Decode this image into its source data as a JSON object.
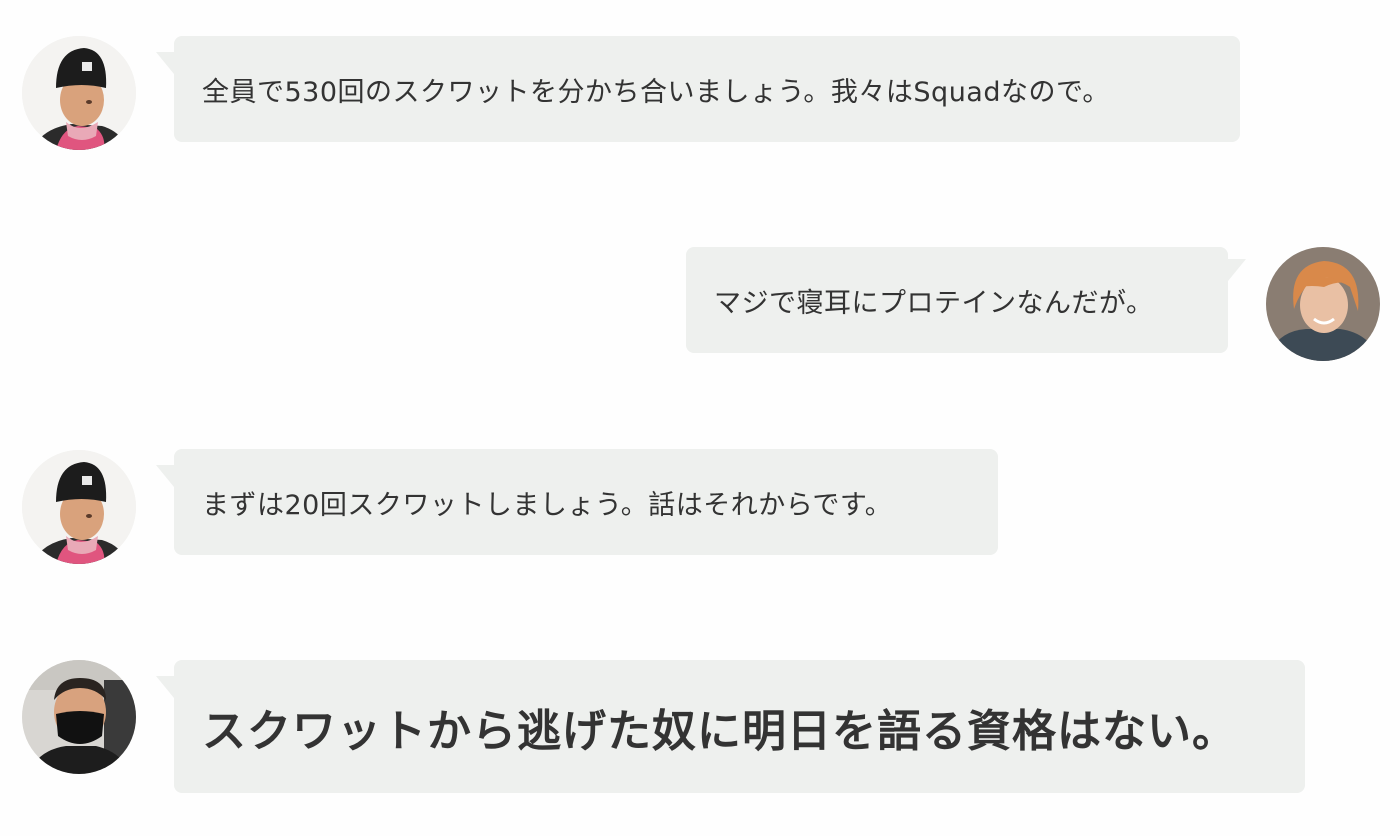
{
  "conversation": {
    "messages": [
      {
        "side": "left",
        "avatar": "avatar-man-beanie-pink-hoodie",
        "text": "全員で530回のスクワットを分かち合いましょう。我々はSquadなので。"
      },
      {
        "side": "right",
        "avatar": "avatar-woman-short-orange-hair",
        "text": "マジで寝耳にプロテインなんだが。"
      },
      {
        "side": "left",
        "avatar": "avatar-man-beanie-pink-hoodie",
        "text": "まずは20回スクワットしましょう。話はそれからです。"
      },
      {
        "side": "left",
        "avatar": "avatar-man-black-mask",
        "text": "スクワットから逃げた奴に明日を語る資格はない。",
        "emphasis": "bold-large"
      }
    ]
  },
  "colors": {
    "background": "#fefefe",
    "bubble": "#eef0ee",
    "text": "#333333"
  }
}
